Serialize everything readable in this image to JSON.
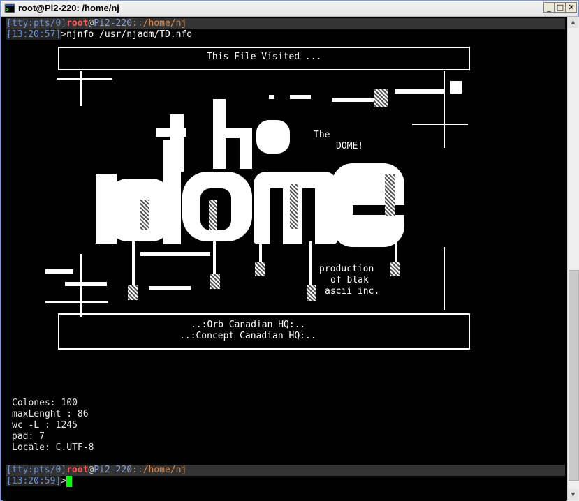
{
  "window": {
    "title": "root@Pi2-220: /home/nj",
    "minimize_icon": "minimize-icon",
    "maximize_icon": "maximize-icon",
    "close_icon": "close-icon",
    "minimize_glyph": "_",
    "maximize_glyph": "□",
    "close_glyph": "✕"
  },
  "prompt1": {
    "tty": "[tty:pts/0]",
    "user": "root",
    "at": "@",
    "host": "Pi2-220",
    "sep": "::",
    "path": "/home/nj",
    "time": "[13:20:57]",
    "arrow": ">",
    "command": "njnfo /usr/njadm/TD.nfo"
  },
  "art": {
    "header": "This File Visited ...",
    "the": "The",
    "dome_label": "DOME!",
    "production_lines": [
      "production",
      "of blak",
      "ascii inc."
    ],
    "footer_lines": [
      "..:Orb Canadian HQ:..",
      "..:Concept Canadian HQ:.."
    ]
  },
  "stats": {
    "colones": "Colones: 100",
    "maxlenght": "maxLenght : 86",
    "wc": "wc -L : 1245",
    "pad": "pad: 7",
    "locale": "Locale: C.UTF-8"
  },
  "prompt2": {
    "tty": "[tty:pts/0]",
    "user": "root",
    "at": "@",
    "host": "Pi2-220",
    "sep": "::",
    "path": "/home/nj",
    "time": "[13:20:59]",
    "arrow": ">"
  },
  "colors": {
    "background": "#000000",
    "prompt_bar": "#333333",
    "user": "#ff5555",
    "path": "#e08a4a",
    "tty": "#6b8fd8",
    "cursor": "#00ff00"
  }
}
